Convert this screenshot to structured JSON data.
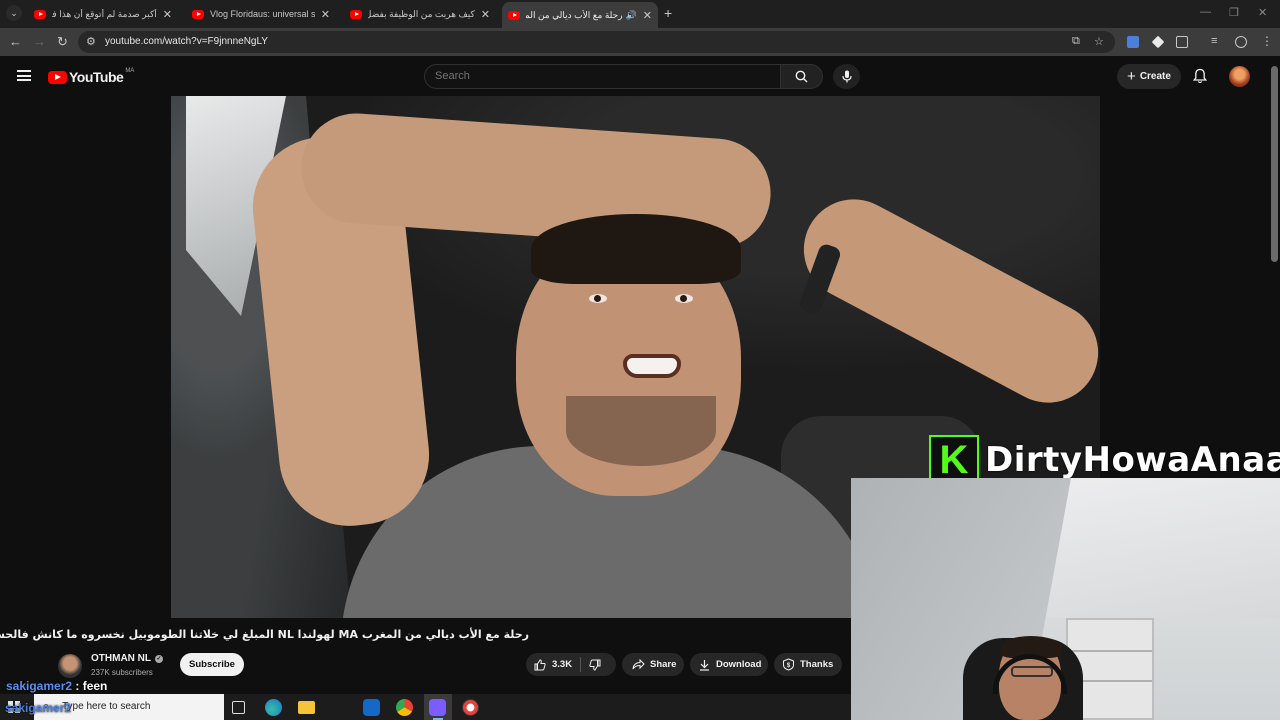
{
  "tabs": [
    {
      "title": "أكبر صدمة لم أتوقع أن هذا في الأ"
    },
    {
      "title": "Vlog Floridaus: universal studios"
    },
    {
      "title": "كيف هربت من الوظيفة بفضل الذ"
    },
    {
      "title": "رحلة مع الأب ديالي من المغرب"
    }
  ],
  "address": {
    "url": "youtube.com/watch?v=F9jnnneNgLY"
  },
  "youtube": {
    "logo_text": "YouTube",
    "country_code": "MA",
    "search_placeholder": "Search",
    "create_label": "Create"
  },
  "overlay": {
    "kick_letter": "K",
    "streamer_name": "DirtyHowaAnaa"
  },
  "video": {
    "title": "رحلة مع الأب ديالي من المغرب MA لهولندا NL المبلغ لي خلاتنا الطوموبيل نخسروه ما كانش فالحساب 😴 💸",
    "channel_name": "OTHMAN NL",
    "subscribers": "237K subscribers",
    "subscribe_label": "Subscribe",
    "likes": "3.3K",
    "share_label": "Share",
    "download_label": "Download",
    "thanks_label": "Thanks"
  },
  "chat": {
    "user": "sakigamer2",
    "message": " : feen",
    "overlap_user": "sakigamer2"
  },
  "taskbar": {
    "search_placeholder": "Type here to search"
  },
  "colors": {
    "youtube_red": "#ff0000",
    "kick_green": "#53fc18",
    "page_bg": "#0f0f0f"
  }
}
